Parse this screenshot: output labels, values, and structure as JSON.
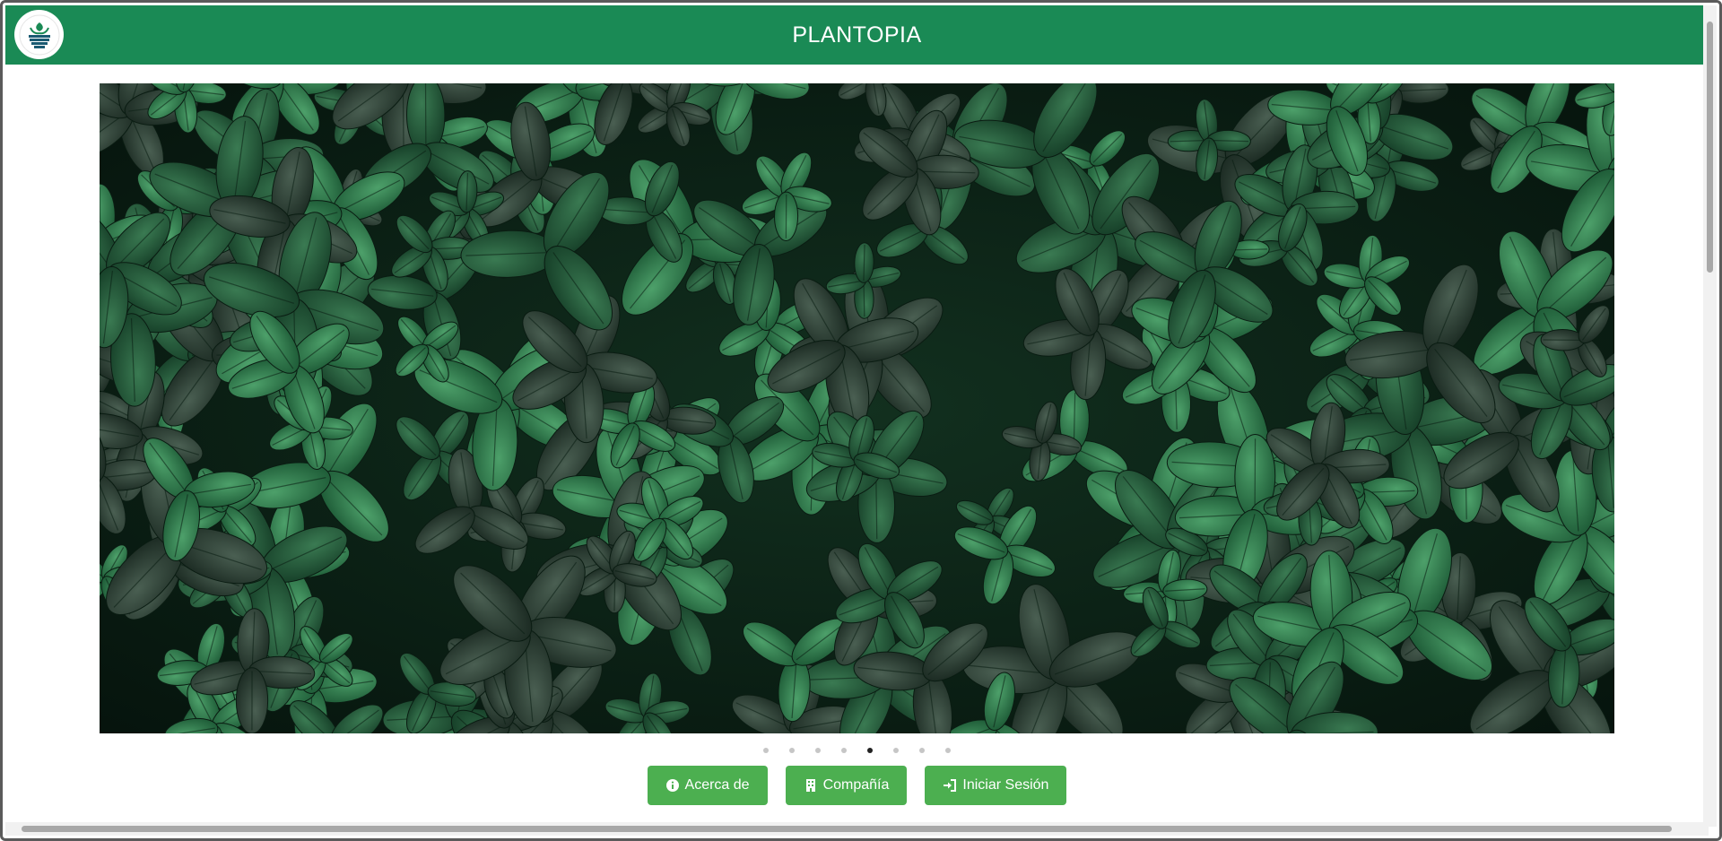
{
  "header": {
    "title": "PLANTOPIA",
    "brand_color": "#1a8a55"
  },
  "carousel": {
    "slide_count": 8,
    "active_index": 4,
    "image_subject": "dark green leafy plants"
  },
  "buttons": [
    {
      "label": "Acerca de",
      "icon": "info-circle-icon"
    },
    {
      "label": "Compañía",
      "icon": "building-icon"
    },
    {
      "label": "Iniciar Sesión",
      "icon": "sign-in-icon"
    }
  ],
  "colors": {
    "button_bg": "#4caf50",
    "page_bg": "#ffffff"
  }
}
